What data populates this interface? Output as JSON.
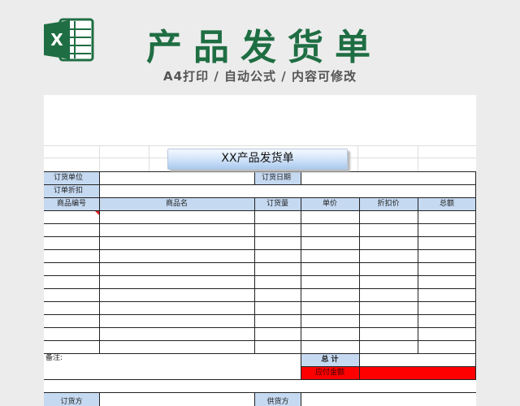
{
  "header": {
    "title": "产品发货单",
    "subtitle": "A4打印 / 自动公式 / 内容可修改",
    "logo_letter": "X"
  },
  "form": {
    "title": "XX产品发货单",
    "labels": {
      "order_unit": "订货单位",
      "order_date": "订货日期",
      "order_discount": "订单折扣",
      "notes": "备注:",
      "total": "总 计",
      "amount_due": "应付金额",
      "orderer": "订货方",
      "supplier": "供货方"
    },
    "columns": [
      "商品编号",
      "商品名",
      "订货量",
      "单价",
      "折扣价",
      "总额"
    ]
  },
  "colors": {
    "brand_green": "#1f6e43",
    "header_fill": "#c5d9f1",
    "due_fill": "#ff0000"
  }
}
